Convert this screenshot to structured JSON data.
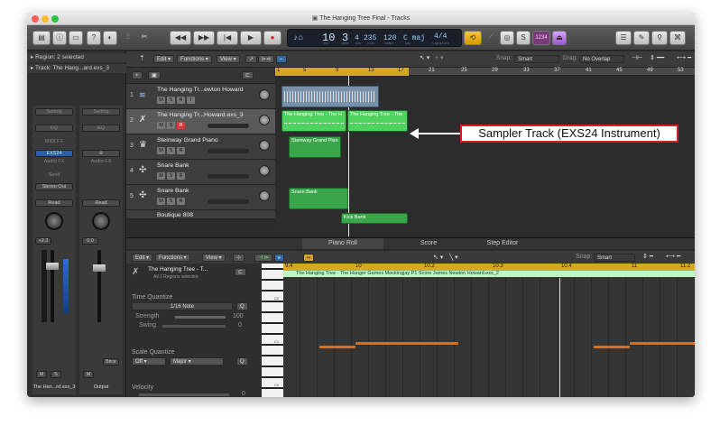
{
  "window": {
    "title": "The Hanging Tree Final - Tracks"
  },
  "toolbar": {
    "lcd": {
      "bar": "10",
      "beat": "3",
      "div": "4",
      "tick": "235",
      "tempo": "120",
      "key": "C maj",
      "signature": "4/4",
      "labels": {
        "bar": "bar",
        "beat": "beat",
        "div": "div",
        "tick": "tick",
        "tempo": "tempo",
        "key": "key",
        "signature": "signature"
      }
    },
    "cpu_label": "1234"
  },
  "inspector": {
    "region_header": "Region: 2 selected",
    "track_header": "Track: The Hang...ard.exs_3",
    "strip_left": {
      "setting": "Setting",
      "eq": "EQ",
      "midi_fx": "MIDI FX",
      "instrument": "EXS24",
      "audio_fx": "Audio FX",
      "send": "Send",
      "output": "Stereo Out",
      "read": "Read",
      "pan_value": "+2.3",
      "name": "The Han...rd.exs_3",
      "m": "M",
      "s": "S"
    },
    "strip_right": {
      "setting": "Setting",
      "eq": "EQ",
      "audio_fx": "Audio FX",
      "read": "Read",
      "pan_value": "0.0",
      "name": "Output",
      "m": "M",
      "bnce": "Bnce"
    }
  },
  "tracks_toolbar": {
    "edit": "Edit",
    "functions": "Functions",
    "view": "View",
    "snap_label": "Snap:",
    "snap_value": "Smart",
    "drag_label": "Drag:",
    "drag_value": "No Overlap"
  },
  "ruler": [
    "1",
    "5",
    "9",
    "13",
    "17",
    "21",
    "25",
    "29",
    "33",
    "37",
    "41",
    "45",
    "49",
    "53"
  ],
  "tracks": [
    {
      "num": "1",
      "name": "The Hanging Tr...ewton Howard",
      "m": "M",
      "s": "S",
      "r": "R",
      "i": "I"
    },
    {
      "num": "2",
      "name": "The Hanging Tr...Howard.exs_3",
      "m": "M",
      "s": "S",
      "r": "R"
    },
    {
      "num": "3",
      "name": "Steinway Grand Piano",
      "m": "M",
      "s": "S",
      "r": "R"
    },
    {
      "num": "4",
      "name": "Snare Bank",
      "m": "M",
      "s": "S",
      "r": "R"
    },
    {
      "num": "5",
      "name": "Snare Bank",
      "m": "M",
      "s": "S",
      "r": "R"
    },
    {
      "num": "",
      "name": "Boutique 808"
    }
  ],
  "regions": {
    "r2a": "The Hanging Tree - The H",
    "r2b": "The Hanging Tree - The",
    "r3": "Steinway Grand Pian",
    "r5": "Snare Bank",
    "r6": "Kick Bank"
  },
  "callout": "Sampler Track (EXS24 Instrument)",
  "lower": {
    "tabs": [
      "Piano Roll",
      "Score",
      "Step Editor"
    ],
    "edit": "Edit",
    "functions": "Functions",
    "view": "View",
    "snap_label": "Snap:",
    "snap_value": "Smart",
    "region_name": "The Hanging Tree - T...",
    "region_sub": "All 2 Regions selected",
    "region_bar": "The Hanging Tree - The Hunger Games Mockingjay P1 Score James Newton Howard.exs_2",
    "time_quantize": "Time Quantize",
    "quantize_value": "1/16 Note",
    "strength_label": "Strength",
    "strength_value": "100",
    "swing_label": "Swing",
    "swing_value": "0",
    "scale_quantize": "Scale Quantize",
    "scale_off": "Off",
    "scale_major": "Major",
    "q": "Q",
    "velocity": "Velocity",
    "velocity_value": "0",
    "ruler": [
      "9.4",
      "10",
      "10.2",
      "10.3",
      "10.4",
      "11",
      "11.2"
    ],
    "keys": [
      "C2",
      "C1",
      "C0"
    ]
  }
}
